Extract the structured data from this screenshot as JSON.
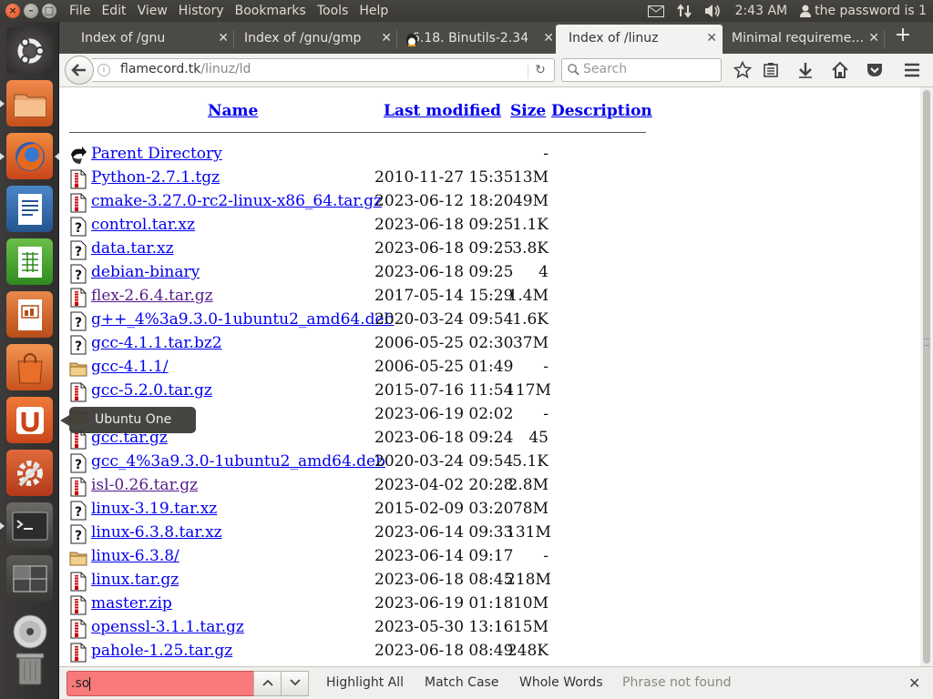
{
  "menubar": [
    "File",
    "Edit",
    "View",
    "History",
    "Bookmarks",
    "Tools",
    "Help"
  ],
  "indicators": {
    "time": "2:43 AM",
    "user": "the password is 1"
  },
  "tabs": [
    {
      "title": "Index of /gnu"
    },
    {
      "title": "Index of /gnu/gmp"
    },
    {
      "title": "6.18. Binutils-2.34"
    },
    {
      "title": "Index of /linuz"
    },
    {
      "title": "Minimal requireme…"
    }
  ],
  "nav": {
    "url_host": "flamecord.tk",
    "url_path": "/linuz/ld",
    "search_placeholder": "Search"
  },
  "listing": {
    "headers": {
      "name": "Name",
      "modified": "Last modified",
      "size": "Size",
      "description": "Description"
    },
    "rows": [
      {
        "icon": "back-icon",
        "name": "Parent Directory",
        "date": "",
        "size": "-"
      },
      {
        "icon": "archive-icon",
        "name": "Python-2.7.1.tgz",
        "date": "2010-11-27 15:35",
        "size": "13M"
      },
      {
        "icon": "archive-icon",
        "name": "cmake-3.27.0-rc2-linux-x86_64.tar.gz",
        "date": "2023-06-12 18:20",
        "size": "49M"
      },
      {
        "icon": "unknown-file-icon",
        "name": "control.tar.xz",
        "date": "2023-06-18 09:25",
        "size": "1.1K"
      },
      {
        "icon": "unknown-file-icon",
        "name": "data.tar.xz",
        "date": "2023-06-18 09:25",
        "size": "3.8K"
      },
      {
        "icon": "unknown-file-icon",
        "name": "debian-binary",
        "date": "2023-06-18 09:25",
        "size": "4"
      },
      {
        "icon": "archive-icon",
        "name": "flex-2.6.4.tar.gz",
        "date": "2017-05-14 15:29",
        "size": "1.4M",
        "visited": true
      },
      {
        "icon": "unknown-file-icon",
        "name": "g++_4%3a9.3.0-1ubuntu2_amd64.deb",
        "date": "2020-03-24 09:54",
        "size": "1.6K"
      },
      {
        "icon": "unknown-file-icon",
        "name": "gcc-4.1.1.tar.bz2",
        "date": "2006-05-25 02:30",
        "size": "37M"
      },
      {
        "icon": "folder-icon",
        "name": "gcc-4.1.1/",
        "date": "2006-05-25 01:49",
        "size": "-"
      },
      {
        "icon": "archive-icon",
        "name": "gcc-5.2.0.tar.gz",
        "date": "2015-07-16 11:54",
        "size": "117M"
      },
      {
        "icon": "folder-icon",
        "name": "",
        "date": "2023-06-19 02:02",
        "size": "-"
      },
      {
        "icon": "archive-icon",
        "name": "gcc.tar.gz",
        "date": "2023-06-18 09:24",
        "size": "45"
      },
      {
        "icon": "unknown-file-icon",
        "name": "gcc_4%3a9.3.0-1ubuntu2_amd64.deb",
        "date": "2020-03-24 09:54",
        "size": "5.1K"
      },
      {
        "icon": "archive-icon",
        "name": "isl-0.26.tar.gz",
        "date": "2023-04-02 20:28",
        "size": "2.8M",
        "visited": true
      },
      {
        "icon": "unknown-file-icon",
        "name": "linux-3.19.tar.xz",
        "date": "2015-02-09 03:20",
        "size": "78M"
      },
      {
        "icon": "unknown-file-icon",
        "name": "linux-6.3.8.tar.xz",
        "date": "2023-06-14 09:33",
        "size": "131M"
      },
      {
        "icon": "folder-icon",
        "name": "linux-6.3.8/",
        "date": "2023-06-14 09:17",
        "size": "-"
      },
      {
        "icon": "archive-icon",
        "name": "linux.tar.gz",
        "date": "2023-06-18 08:45",
        "size": "218M"
      },
      {
        "icon": "archive-icon",
        "name": "master.zip",
        "date": "2023-06-19 01:18",
        "size": "10M"
      },
      {
        "icon": "archive-icon",
        "name": "openssl-3.1.1.tar.gz",
        "date": "2023-05-30 13:16",
        "size": "15M"
      },
      {
        "icon": "archive-icon",
        "name": "pahole-1.25.tar.gz",
        "date": "2023-06-18 08:49",
        "size": "248K"
      }
    ]
  },
  "tooltip": "Ubuntu One",
  "findbar": {
    "query": ".so",
    "highlight_all": "Highlight All",
    "match_case": "Match Case",
    "whole_words": "Whole Words",
    "status": "Phrase not found"
  }
}
